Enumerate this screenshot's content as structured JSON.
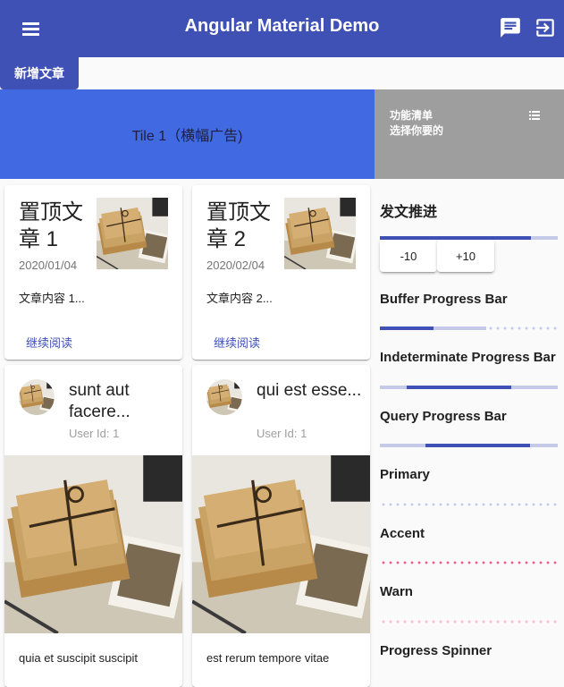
{
  "toolbar": {
    "title": "Angular Material Demo",
    "menu_icon": "menu-icon",
    "chat_icon": "chat-icon",
    "logout_icon": "exit-to-app-icon"
  },
  "add_article_label": "新增文章",
  "tiles": {
    "banner_label": "Tile 1（横幅广告)",
    "side_line1": "功能清单",
    "side_line2": "选择你要的",
    "side_icon": "list-icon"
  },
  "pinned_articles": [
    {
      "title": "置顶文章 1",
      "date": "2020/01/04",
      "content": "文章内容 1...",
      "more": "继续阅读"
    },
    {
      "title": "置顶文章 2",
      "date": "2020/02/04",
      "content": "文章内容 2...",
      "more": "继续阅读"
    }
  ],
  "posts": [
    {
      "title": "sunt aut facere...",
      "user": "User Id: 1",
      "body": "quia et suscipit suscipit"
    },
    {
      "title": "qui est esse...",
      "user": "User Id: 1",
      "body": "est rerum tempore vitae"
    }
  ],
  "sidebar": {
    "post_progress": {
      "label": "发文推进",
      "value_fraction": 0.85
    },
    "minus_label": "-10",
    "plus_label": "+10",
    "buffer": {
      "label": "Buffer Progress Bar",
      "value_fraction": 0.3,
      "buffer_fraction": 0.6
    },
    "indeterminate": {
      "label": "Indeterminate Progress Bar"
    },
    "query": {
      "label": "Query Progress Bar"
    },
    "primary_label": "Primary",
    "accent_label": "Accent",
    "warn_label": "Warn",
    "spinner_label": "Progress Spinner"
  },
  "colors": {
    "primary": "#3f51b5",
    "banner": "#4169e1",
    "accent": "#ff4081",
    "warn": "#f8bbd0"
  }
}
